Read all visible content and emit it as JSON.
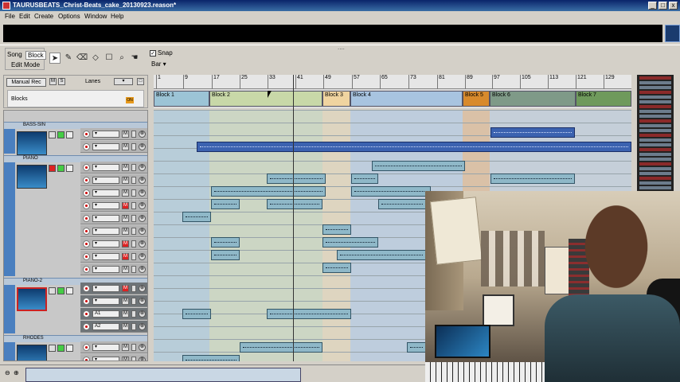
{
  "window": {
    "title": "TAURUSBEATS_Christ-Beats_cake_20130923.reason*",
    "minimize": "_",
    "maximize": "□",
    "close": "x"
  },
  "menu": [
    "File",
    "Edit",
    "Create",
    "Options",
    "Window",
    "Help"
  ],
  "toolbar": {
    "mode_song": "Song",
    "mode_block": "Block",
    "edit_mode": "Edit Mode",
    "snap_label": "Snap",
    "snap_checked": "✓",
    "snap_value": "Bar",
    "grip": "....",
    "tools": [
      "select-arrow-icon",
      "pencil-icon",
      "eraser-icon",
      "razor-icon",
      "mute-icon",
      "magnify-icon",
      "hand-icon"
    ]
  },
  "track_header": {
    "manual_rec": "Manual Rec",
    "m": "M",
    "s": "S",
    "lanes": "Lanes",
    "blocks": "Blocks",
    "on": "ON"
  },
  "ruler": [
    "1",
    "9",
    "17",
    "25",
    "33",
    "41",
    "49",
    "57",
    "65",
    "73",
    "81",
    "89",
    "97",
    "105",
    "113",
    "121",
    "129"
  ],
  "blocks": [
    {
      "label": "Block 1",
      "color": "#9cc4d6"
    },
    {
      "label": "Block 2",
      "color": "#c8d8a8"
    },
    {
      "label": "Block 3",
      "color": "#f0d4a0"
    },
    {
      "label": "Block 4",
      "color": "#a8c4e0"
    },
    {
      "label": "Block 5",
      "color": "#d88a2c"
    },
    {
      "label": "Block 6",
      "color": "#7f9a88"
    },
    {
      "label": "Block 7",
      "color": "#6f9a5c"
    }
  ],
  "devices": [
    {
      "name": "BASS-SIN"
    },
    {
      "name": "PIANO"
    },
    {
      "name": "PIANO-2"
    },
    {
      "name": "RHODES"
    }
  ],
  "lane_controls": {
    "m": "M",
    "sel_arrow": "▾",
    "x": "⊗",
    "a1": "A1",
    "a2": "A2"
  },
  "colors": {
    "accent_blue": "#3b62b0",
    "clip": "#8fb8c8",
    "record_red": "#cc0000"
  }
}
